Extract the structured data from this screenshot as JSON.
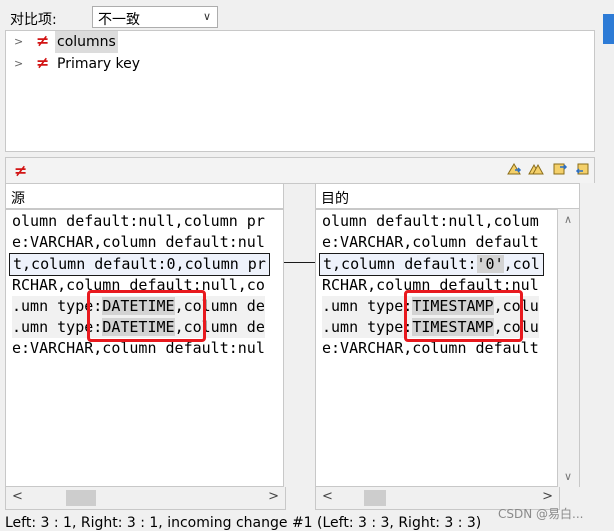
{
  "filter": {
    "label": "对比项:",
    "value": "不一致"
  },
  "tree": [
    {
      "label": "columns",
      "icon": "not-equal-icon"
    },
    {
      "label": "Primary key",
      "icon": "not-equal-icon"
    }
  ],
  "diff_symbol": "≠",
  "panes": {
    "left_title": "源",
    "right_title": "目的"
  },
  "left_lines": [
    {
      "text": "olumn default:null,column pr"
    },
    {
      "text": "e:VARCHAR,column default:nul"
    },
    {
      "text": "t,column default:0,column pr"
    },
    {
      "text": "RCHAR,column default:null,co"
    },
    {
      "pre": ".umn type:",
      "hl": "DATETIME",
      "post": ",column de"
    },
    {
      "pre": ".umn type:",
      "hl": "DATETIME",
      "post": ",column de"
    },
    {
      "text": "e:VARCHAR,column default:nul"
    }
  ],
  "right_lines": [
    {
      "text": "olumn default:null,colum"
    },
    {
      "text": "e:VARCHAR,column default"
    },
    {
      "pre": "t,column default:",
      "hl": "'0'",
      "post": ",col"
    },
    {
      "text": "RCHAR,column default:nul"
    },
    {
      "pre": ".umn type:",
      "hl": "TIMESTAMP",
      "post": ",colu"
    },
    {
      "pre": ".umn type:",
      "hl": "TIMESTAMP",
      "post": ",colu"
    },
    {
      "text": "e:VARCHAR,column default"
    }
  ],
  "status": "Left: 3 : 1, Right: 3 : 1, incoming change #1 (Left: 3 : 3, Right: 3 : 3)",
  "watermark": "CSDN @易白...",
  "colors": {
    "diff_red": "#d21414",
    "annotation_red": "#e8191e"
  }
}
